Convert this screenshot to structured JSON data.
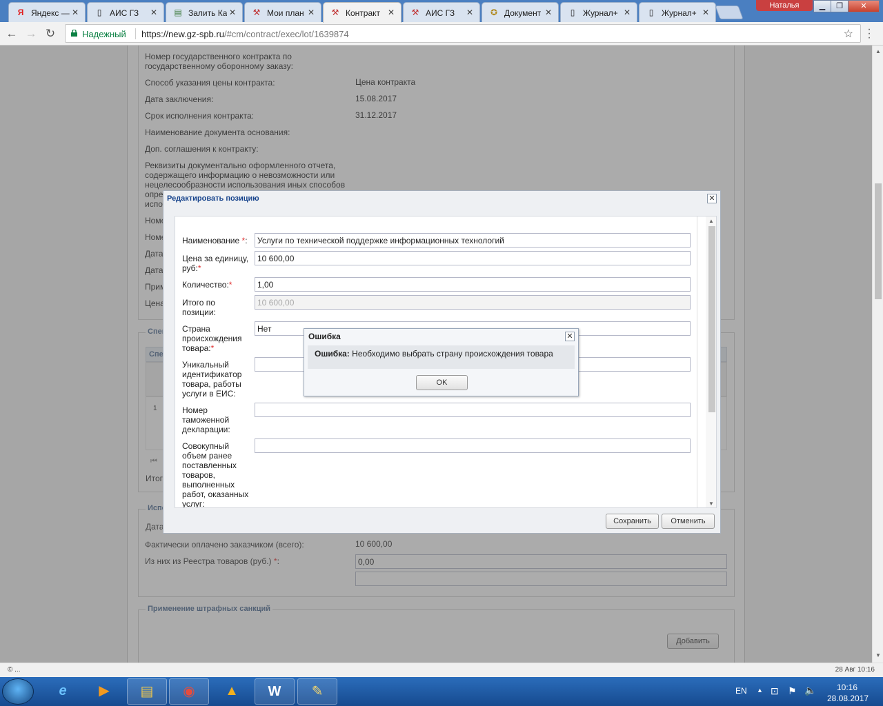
{
  "browser": {
    "tabs": [
      {
        "label": "Яндекс —",
        "icon": "Я",
        "active": false
      },
      {
        "label": "АИС ГЗ",
        "icon": "▯",
        "active": false
      },
      {
        "label": "Залить Ка",
        "icon": "▤",
        "active": false
      },
      {
        "label": "Мои план",
        "icon": "⚒",
        "active": false
      },
      {
        "label": "Контракт",
        "icon": "⚒",
        "active": true
      },
      {
        "label": "АИС ГЗ",
        "icon": "⚒",
        "active": false
      },
      {
        "label": "Документ",
        "icon": "✪",
        "active": false
      },
      {
        "label": "Журнал+",
        "icon": "▯",
        "active": false
      },
      {
        "label": "Журнал+",
        "icon": "▯",
        "active": false
      }
    ],
    "user": "Наталья",
    "secure_label": "Надежный",
    "url_host": "https://new.gz-spb.ru",
    "url_path": "/#cm/contract/exec/lot/1639874"
  },
  "page": {
    "rows": [
      {
        "label": "Номер государственного контракта по\nгосударственному оборонному заказу:",
        "value": ""
      },
      {
        "label": "Способ указания цены контракта:",
        "value": "Цена контракта"
      },
      {
        "label": "Дата заключения:",
        "value": "15.08.2017"
      },
      {
        "label": "Срок исполнения контракта:",
        "value": "31.12.2017"
      },
      {
        "label": "Наименование документа основания:",
        "value": ""
      },
      {
        "label": "Доп. соглашения к контракту:",
        "value": ""
      },
      {
        "label": "Реквизиты документально оформленного отчета,\nсодержащего информацию о невозможности или\nнецелесообразности использования иных способов\nопре",
        "value": ""
      },
      {
        "label": "испо",
        "value": ""
      },
      {
        "label": "Номе",
        "value": ""
      },
      {
        "label": "Номе",
        "value": ""
      },
      {
        "label": "Дата",
        "value": ""
      },
      {
        "label": "Дата",
        "value": ""
      },
      {
        "label": "Прим",
        "value": ""
      },
      {
        "label": "Цена",
        "value": ""
      }
    ],
    "spec_legend": "Спец",
    "spec_header": "Спец",
    "spec_row_num": "1",
    "total_label": "Итог",
    "exec_legend": "Испо",
    "exec_date_label": "Дата",
    "paid_label": "Фактически оплачено заказчиком (всего):",
    "paid_value": "10 600,00",
    "registry_label": "Из них из Реестра товаров (руб.)",
    "registry_value": "0,00",
    "penalty_legend": "Применение штрафных санкций",
    "add_button": "Добавить"
  },
  "dialog": {
    "title": "Редактировать позицию",
    "fields": {
      "name_label": "Наименование",
      "name_value": "Услуги по технической поддержке информационных технологий",
      "price_label_1": "Цена за единицу,",
      "price_label_2": "руб:",
      "price_value": "10 600,00",
      "qty_label": "Количество:",
      "qty_value": "1,00",
      "total_label": "Итого по\nпозиции:",
      "total_value": "10 600,00",
      "country_label": "Страна\nпроисхождения\nтовара:",
      "country_value": "Нет",
      "uid_label": "Уникальный\nидентификатор\nтовара, работы\nуслуги в ЕИС:",
      "customs_label": "Номер\nтаможенной\nдекларации:",
      "volume_label": "Совокупный\nобъем ранее\nпоставленных\nтоваров,\nвыполненных\nработ, оказанных\nуслуг:"
    },
    "save_button": "Сохранить",
    "cancel_button": "Отменить"
  },
  "error": {
    "title": "Ошибка",
    "bold": "Ошибка:",
    "message": " Необходимо выбрать страну происхождения товара",
    "ok_button": "OK"
  },
  "status": {
    "left": "© ...",
    "right": "28 Авг 10:16"
  },
  "taskbar": {
    "lang": "EN",
    "time": "10:16",
    "date": "28.08.2017"
  }
}
